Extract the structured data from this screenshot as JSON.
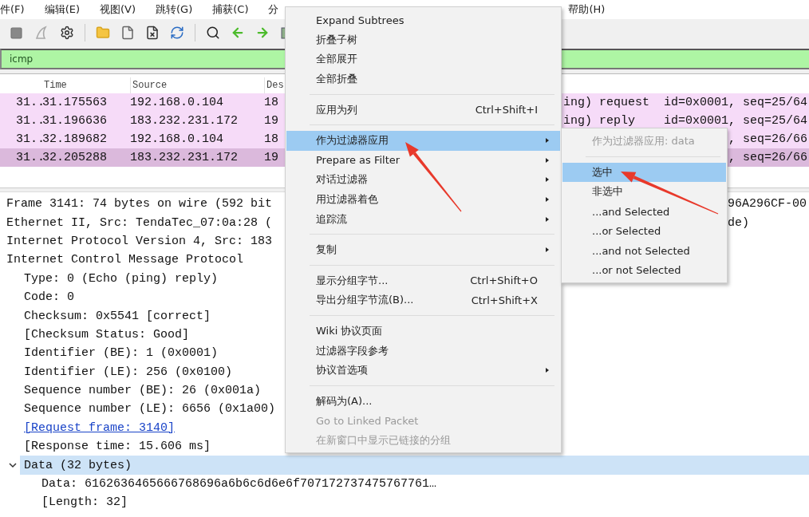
{
  "menu_bar": [
    "件(F)",
    "编辑(E)",
    "视图(V)",
    "跳转(G)",
    "捕获(C)",
    "分",
    "帮助(H)"
  ],
  "filter": {
    "value": "icmp"
  },
  "packet_list": {
    "columns": [
      "Time",
      "Source",
      "Des"
    ],
    "rows": [
      {
        "no": "31..",
        "time": "31.175563",
        "source": "192.168.0.104",
        "destination": "18",
        "info": "ing) request  id=0x0001, seq=25/64",
        "selected": false
      },
      {
        "no": "31..",
        "time": "31.196636",
        "source": "183.232.231.172",
        "destination": "19",
        "info": "ing) reply    id=0x0001, seq=25/64",
        "selected": false
      },
      {
        "no": "31..",
        "time": "32.189682",
        "source": "192.168.0.104",
        "destination": "18",
        "info": ", seq=26/66",
        "selected": false
      },
      {
        "no": "31..",
        "time": "32.205288",
        "source": "183.232.231.172",
        "destination": "19",
        "info": ", seq=26/66",
        "selected": true
      }
    ]
  },
  "details": [
    {
      "text": "Frame 3141: 74 bytes on wire (592 bit",
      "tail": "96A296CF-00",
      "selected": false
    },
    {
      "text": "Ethernet II, Src: TendaTec_07:0a:28 (",
      "tail": "de)",
      "selected": false
    },
    {
      "text": "Internet Protocol Version 4, Src: 183",
      "selected": false
    },
    {
      "text": "Internet Control Message Protocol",
      "selected": false,
      "children": [
        {
          "text": "Type: 0 (Echo (ping) reply)",
          "selected": false
        },
        {
          "text": "Code: 0",
          "selected": false
        },
        {
          "text": "Checksum: 0x5541 [correct]",
          "selected": false
        },
        {
          "text": "[Checksum Status: Good]",
          "selected": false
        },
        {
          "text": "Identifier (BE): 1 (0x0001)",
          "selected": false
        },
        {
          "text": "Identifier (LE): 256 (0x0100)",
          "selected": false
        },
        {
          "text": "Sequence number (BE): 26 (0x001a)",
          "selected": false
        },
        {
          "text": "Sequence number (LE): 6656 (0x1a00)",
          "selected": false
        },
        {
          "text": "[Request frame: 3140]",
          "kind": "link",
          "selected": false
        },
        {
          "text": "[Response time: 15.606 ms]",
          "selected": false
        },
        {
          "text": "Data (32 bytes)",
          "expanded": true,
          "selected": true,
          "children": [
            {
              "text": "Data: 6162636465666768696a6b6c6d6e6f707172737475767761…",
              "selected": false
            },
            {
              "text": "[Length: 32]",
              "selected": false
            }
          ]
        }
      ]
    }
  ],
  "context_menu": [
    {
      "kind": "item",
      "label": "Expand Subtrees",
      "selected": false
    },
    {
      "kind": "item",
      "label": "折叠子树",
      "selected": false
    },
    {
      "kind": "item",
      "label": "全部展开",
      "selected": false
    },
    {
      "kind": "item",
      "label": "全部折叠",
      "selected": false
    },
    {
      "kind": "separator"
    },
    {
      "kind": "item",
      "label": "应用为列",
      "shortcut": "Ctrl+Shift+I",
      "selected": false
    },
    {
      "kind": "separator"
    },
    {
      "kind": "item",
      "label": "作为过滤器应用",
      "submenu": true,
      "selected": true
    },
    {
      "kind": "item",
      "label": "Prepare as Filter",
      "submenu": true,
      "selected": false
    },
    {
      "kind": "item",
      "label": "对话过滤器",
      "submenu": true,
      "selected": false
    },
    {
      "kind": "item",
      "label": "用过滤器着色",
      "submenu": true,
      "selected": false
    },
    {
      "kind": "item",
      "label": "追踪流",
      "submenu": true,
      "selected": false
    },
    {
      "kind": "separator"
    },
    {
      "kind": "item",
      "label": "复制",
      "submenu": true,
      "selected": false
    },
    {
      "kind": "separator"
    },
    {
      "kind": "item",
      "label": "显示分组字节...",
      "shortcut": "Ctrl+Shift+O",
      "selected": false
    },
    {
      "kind": "item",
      "label": "导出分组字节流(B)...",
      "shortcut": "Ctrl+Shift+X",
      "selected": false
    },
    {
      "kind": "separator"
    },
    {
      "kind": "item",
      "label": "Wiki 协议页面",
      "selected": false
    },
    {
      "kind": "item",
      "label": "过滤器字段参考",
      "selected": false
    },
    {
      "kind": "item",
      "label": "协议首选项",
      "submenu": true,
      "selected": false
    },
    {
      "kind": "separator"
    },
    {
      "kind": "item",
      "label": "解码为(A)...",
      "selected": false
    },
    {
      "kind": "item",
      "label": "Go to Linked Packet",
      "disabled": true,
      "selected": false
    },
    {
      "kind": "item",
      "label": "在新窗口中显示已链接的分组",
      "disabled": true,
      "selected": false
    }
  ],
  "submenu": [
    {
      "kind": "item",
      "label": "作为过滤器应用: data",
      "disabled": true,
      "selected": false
    },
    {
      "kind": "separator"
    },
    {
      "kind": "item",
      "label": "选中",
      "selected": true
    },
    {
      "kind": "item",
      "label": "非选中",
      "selected": false
    },
    {
      "kind": "item",
      "label": "...and Selected",
      "selected": false
    },
    {
      "kind": "item",
      "label": "...or Selected",
      "selected": false
    },
    {
      "kind": "item",
      "label": "...and not Selected",
      "selected": false
    },
    {
      "kind": "item",
      "label": "...or not Selected",
      "selected": false
    }
  ],
  "annotations": [
    {
      "kind": "arrow"
    },
    {
      "kind": "arrow"
    }
  ]
}
